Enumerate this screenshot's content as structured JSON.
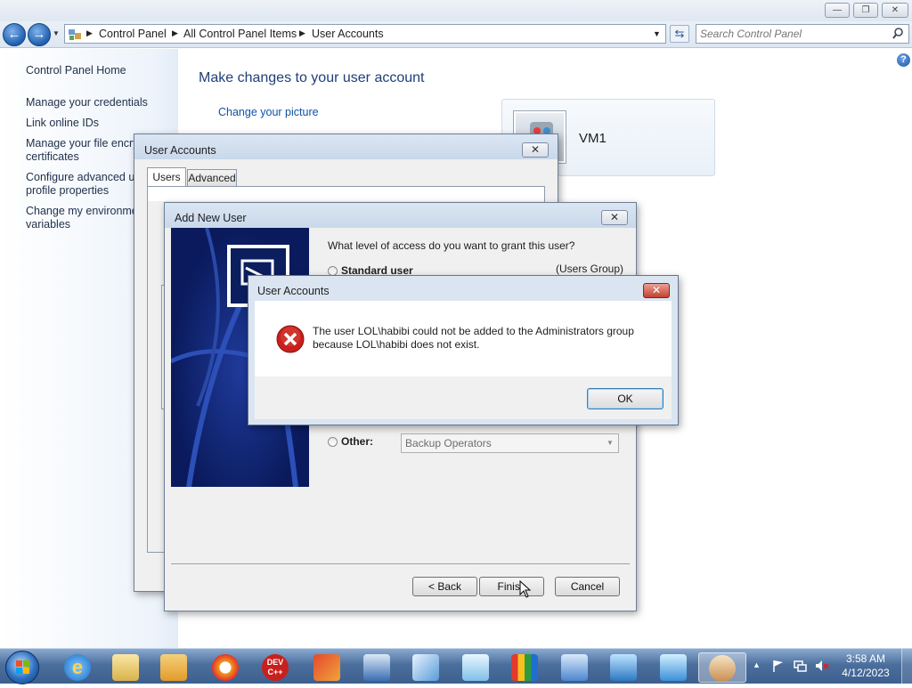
{
  "explorer": {
    "window_buttons": {
      "minimize": "—",
      "restore": "❐",
      "close": "✕"
    },
    "breadcrumb": [
      "Control Panel",
      "All Control Panel Items",
      "User Accounts"
    ],
    "search_placeholder": "Search Control Panel"
  },
  "left_pane": {
    "home": "Control Panel Home",
    "links": [
      "Manage your credentials",
      "Link online IDs",
      "Manage your file encry",
      "certificates",
      "Configure advanced us",
      "profile properties",
      "Change my environme",
      "variables"
    ]
  },
  "main": {
    "heading": "Make changes to your user account",
    "change_picture": "Change your picture",
    "account_name": "VM1"
  },
  "user_accounts_dialog": {
    "title": "User Accounts",
    "tabs": [
      "Users",
      "Advanced"
    ]
  },
  "add_user_wizard": {
    "title": "Add New User",
    "question": "What level of access do you want to grant this user?",
    "standard_label": "Standard user",
    "standard_group": "(Users Group)",
    "other_label": "Other:",
    "other_value": "Backup Operators",
    "back": "< Back",
    "finish": "Finish",
    "cancel": "Cancel"
  },
  "error_dialog": {
    "title": "User Accounts",
    "message_line1": "The user LOL\\habibi could not be added to the Administrators group",
    "message_line2": "because LOL\\habibi does not exist.",
    "ok": "OK"
  },
  "taskbar": {
    "icons": [
      "start-orb",
      "internet-explorer",
      "file-explorer",
      "media-player",
      "security-app",
      "dev-cpp",
      "ccleaner",
      "remote-desktop",
      "send-app",
      "notepad-app",
      "avg-antivirus",
      "arch-app",
      "screen-app",
      "control-panel",
      "user-accounts"
    ],
    "dev_label": "DEV\nC++",
    "time": "3:58 AM",
    "date": "4/12/2023"
  },
  "colors": {
    "link": "#0d52a8",
    "accent": "#1e5aa8",
    "taskbar": "#4b6f9d",
    "error_red": "#c8201d"
  }
}
